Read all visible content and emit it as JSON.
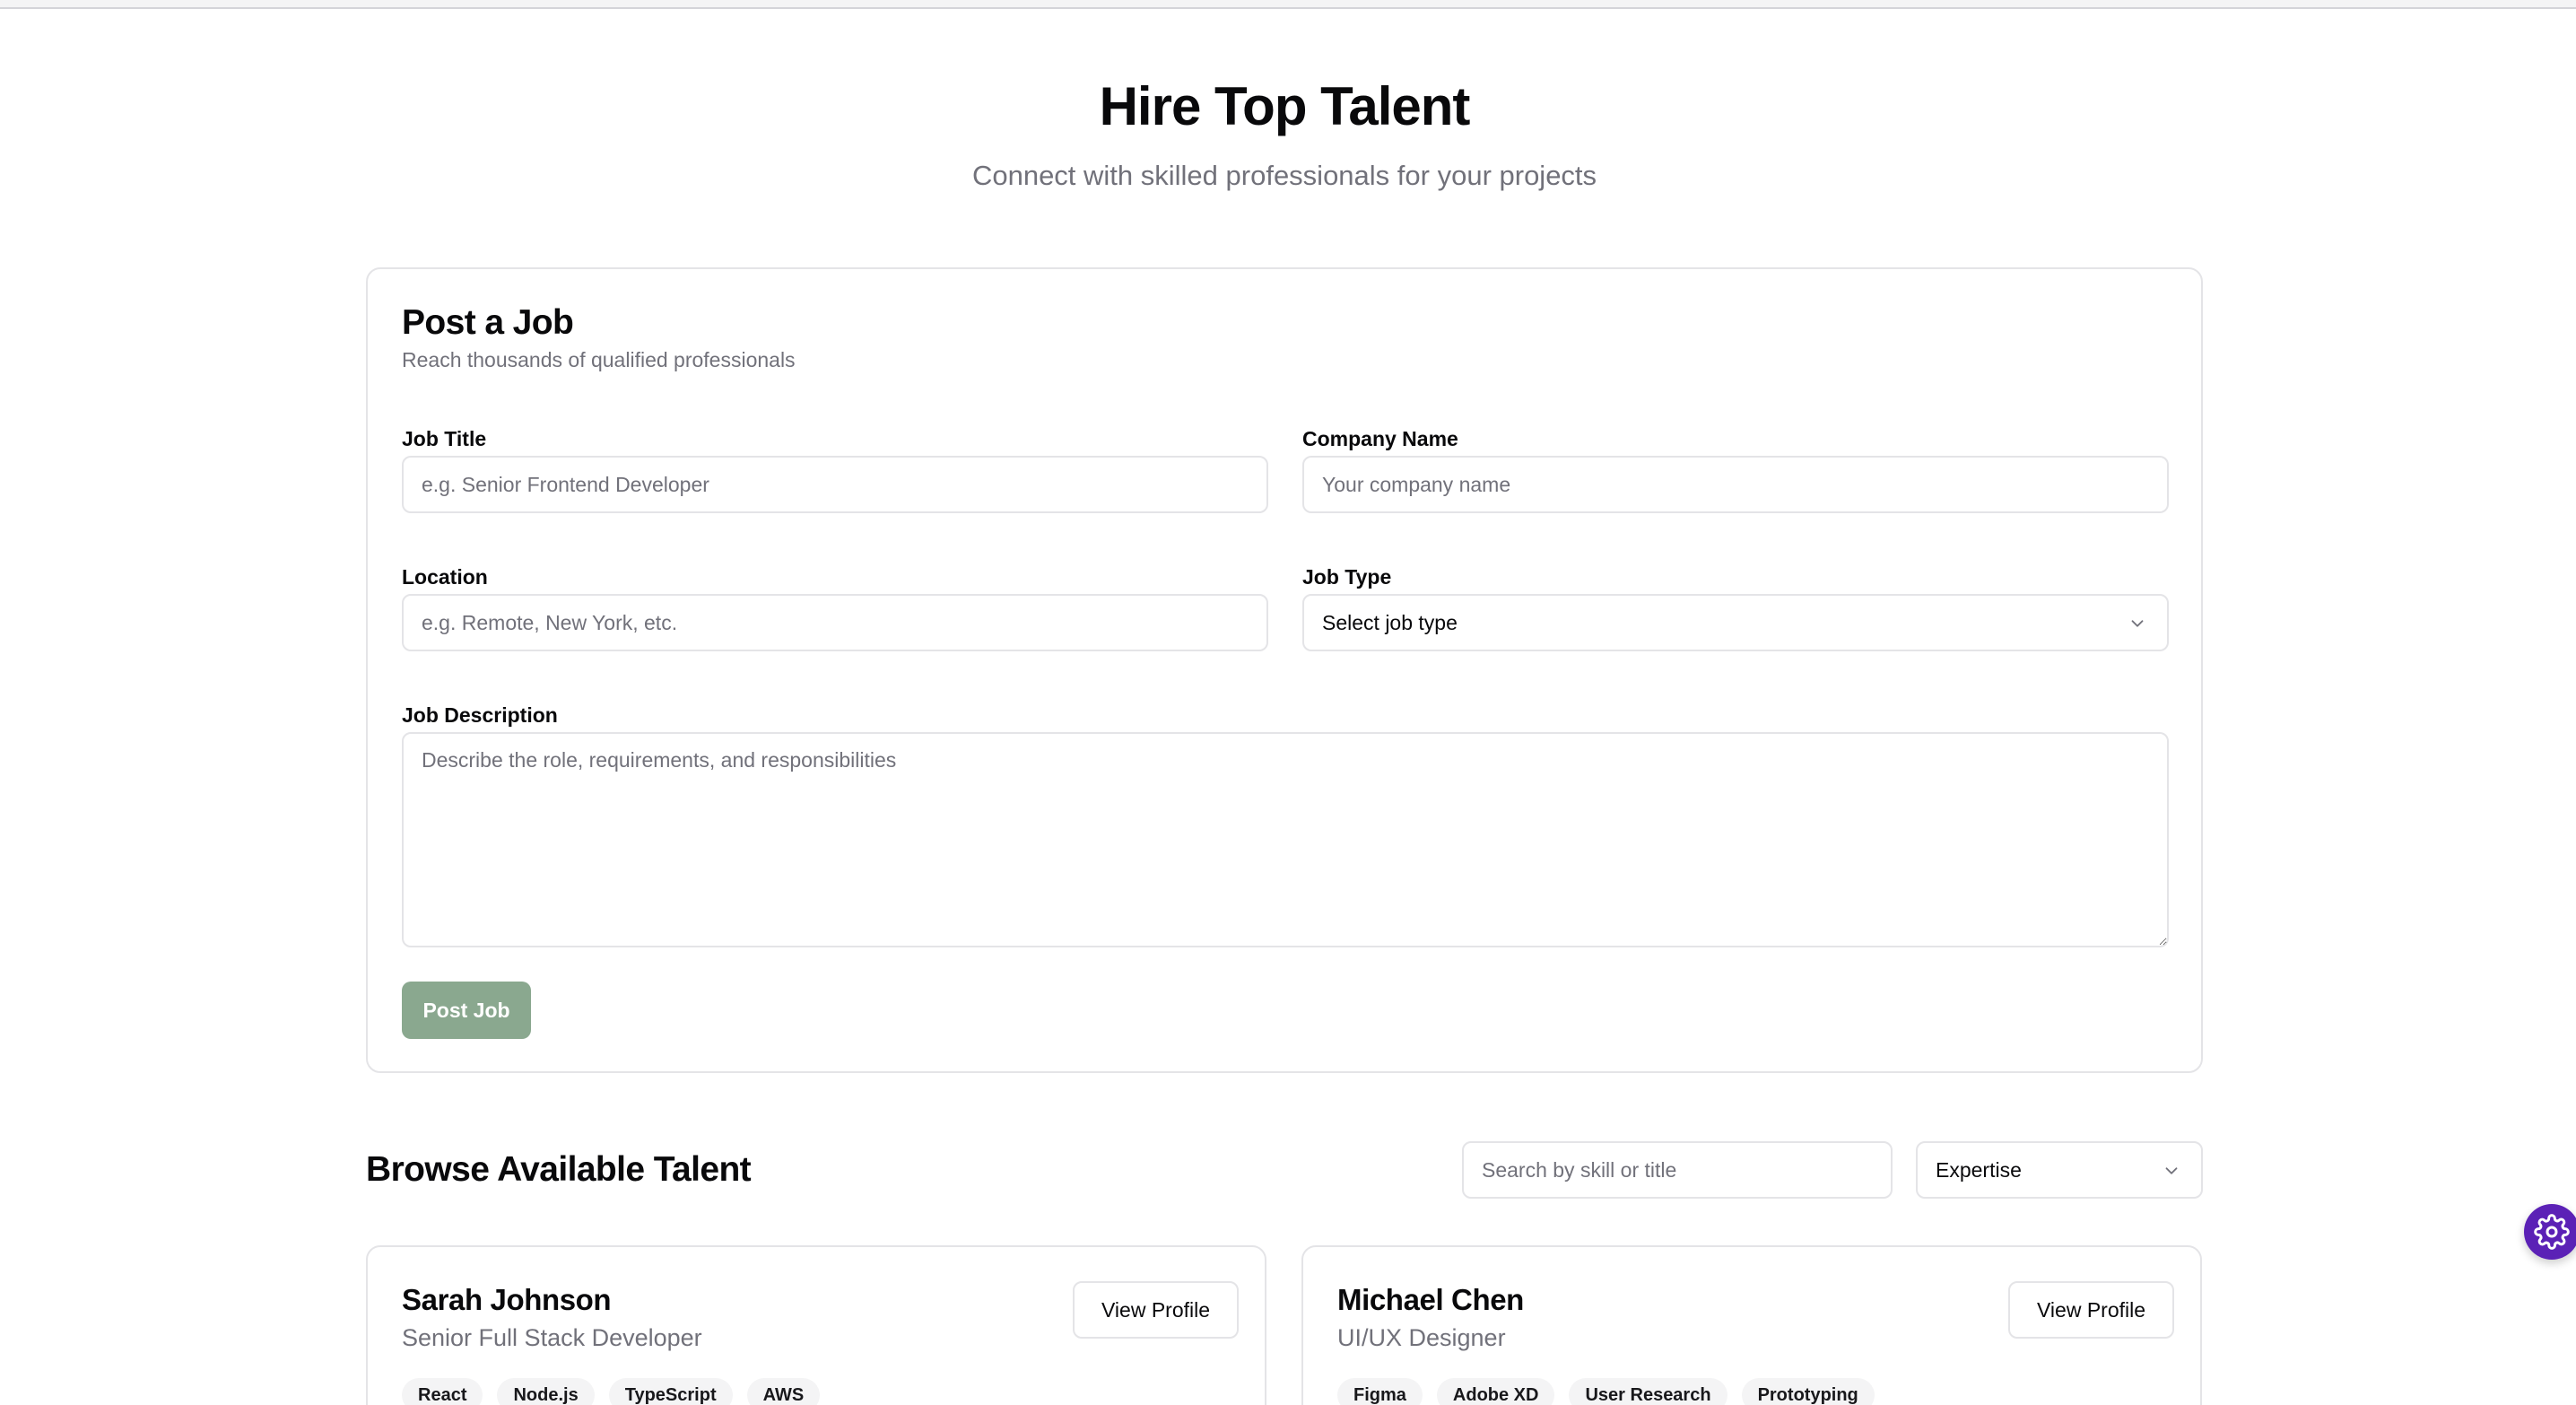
{
  "hero": {
    "title": "Hire Top Talent",
    "subtitle": "Connect with skilled professionals for your projects"
  },
  "post_job": {
    "title": "Post a Job",
    "subtitle": "Reach thousands of qualified professionals",
    "fields": {
      "job_title": {
        "label": "Job Title",
        "placeholder": "e.g. Senior Frontend Developer"
      },
      "company_name": {
        "label": "Company Name",
        "placeholder": "Your company name"
      },
      "location": {
        "label": "Location",
        "placeholder": "e.g. Remote, New York, etc."
      },
      "job_type": {
        "label": "Job Type",
        "value": "Select job type"
      },
      "description": {
        "label": "Job Description",
        "placeholder": "Describe the role, requirements, and responsibilities"
      }
    },
    "submit_label": "Post Job",
    "submit_color": "#8aa88f"
  },
  "browse": {
    "title": "Browse Available Talent",
    "search_placeholder": "Search by skill or title",
    "expertise_value": "Expertise",
    "talent": [
      {
        "name": "Sarah Johnson",
        "role": "Senior Full Stack Developer",
        "button": "View Profile",
        "skills": [
          "React",
          "Node.js",
          "TypeScript",
          "AWS"
        ]
      },
      {
        "name": "Michael Chen",
        "role": "UI/UX Designer",
        "button": "View Profile",
        "skills": [
          "Figma",
          "Adobe XD",
          "User Research",
          "Prototyping"
        ]
      }
    ]
  },
  "fab": {
    "icon": "gear-icon",
    "color": "#5b21b6"
  }
}
